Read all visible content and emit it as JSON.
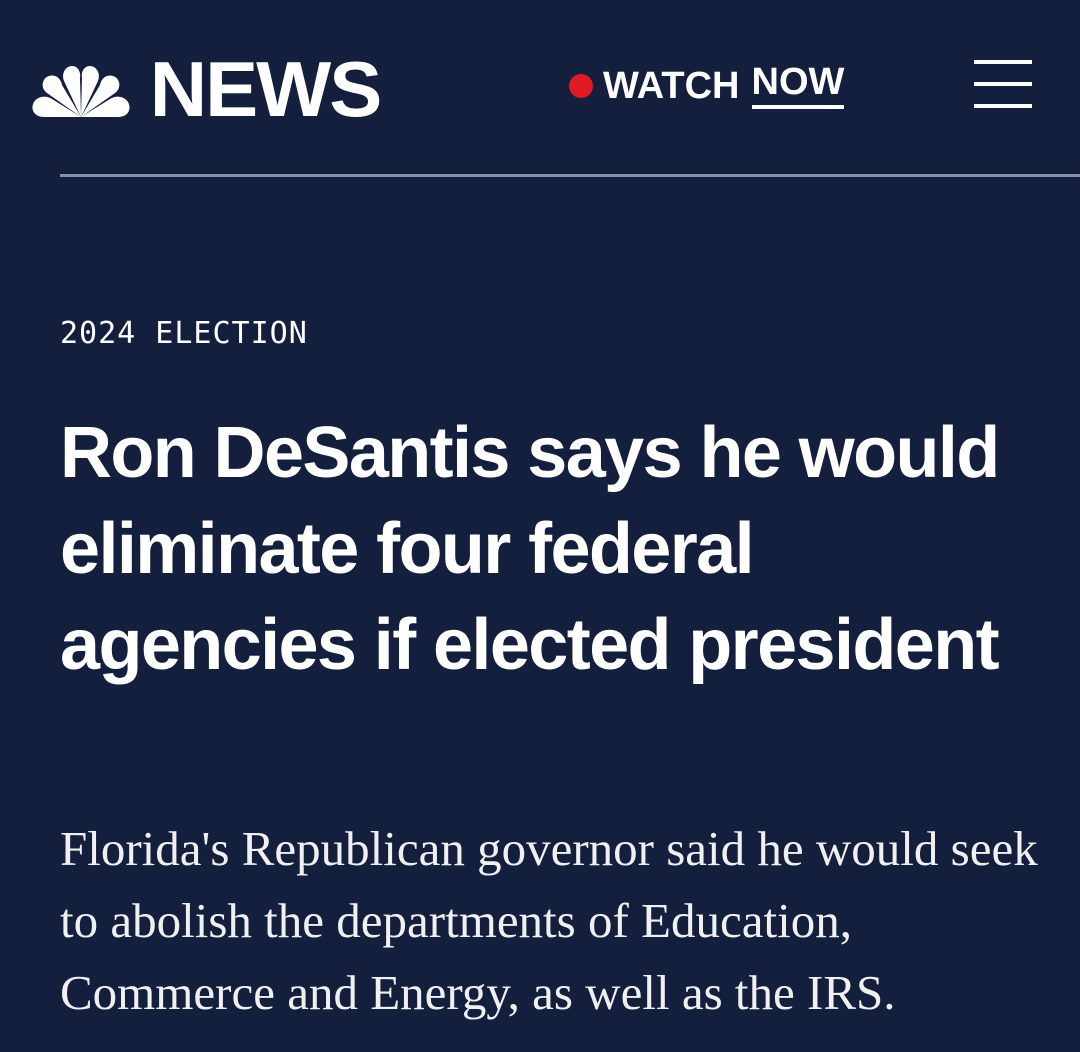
{
  "header": {
    "logo_text": "NEWS",
    "logo_icon": "nbc-peacock-icon",
    "watch_label": "WATCH",
    "watch_now_label": "NOW",
    "live_dot_color": "#e01a22",
    "menu_icon": "hamburger-menu-icon"
  },
  "article": {
    "section": "2024 ELECTION",
    "headline": "Ron DeSantis says he would eliminate four federal agencies if elected president",
    "dek": "Florida's Republican governor said he would seek to abolish the departments of Education, Commerce and Energy, as well as the IRS."
  },
  "colors": {
    "background": "#131f3c",
    "text": "#ffffff",
    "divider": "#8a90a4"
  }
}
